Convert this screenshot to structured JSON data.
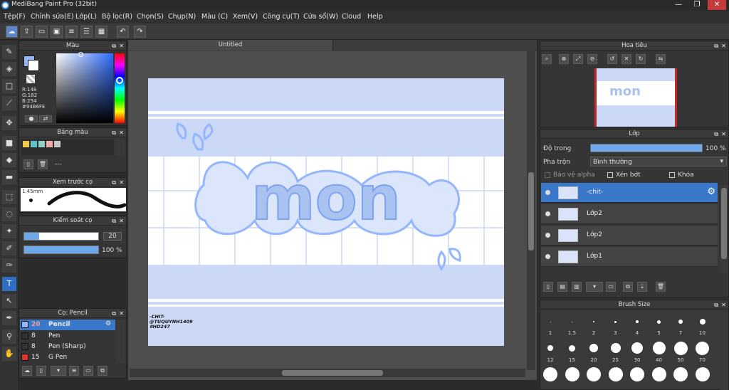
{
  "app": {
    "title": "MediBang Paint Pro (32bit)"
  },
  "window_controls": {
    "minimize": "—",
    "restore": "❐",
    "close": "✕"
  },
  "menu": [
    "Tệp(F)",
    "Chỉnh sửa(E)",
    "Lớp(L)",
    "Bộ lọc(R)",
    "Chọn(S)",
    "Chụp(N)",
    "Màu (C)",
    "Xem(V)",
    "Công cụ(T)",
    "Cửa sổ(W)",
    "Cloud",
    "Help"
  ],
  "color_panel": {
    "title": "Màu",
    "r": "R:148",
    "g": "G:182",
    "b": "B:254",
    "hex": "#94B6FE",
    "fg_color": "#94B6FE",
    "bg_color": "#FFFFFF"
  },
  "palette_panel": {
    "title": "Bảng màu",
    "swatches": [
      "#f2c94c",
      "#5fc4c9",
      "#8fd0c7",
      "#f0a8a8",
      "#c8c8c8"
    ],
    "dash": "---"
  },
  "brush_preview": {
    "title": "Xem trước cọ",
    "size": "1.45mm"
  },
  "brush_control": {
    "title": "Kiểm soát cọ",
    "size_value": "20",
    "opacity_value": "100 %",
    "size_fraction": 0.2,
    "opacity_fraction": 1.0
  },
  "brush_list": {
    "title": "Cọ: Pencil",
    "items": [
      {
        "size": "20",
        "name": "Pencil",
        "color": "#94B6FE"
      },
      {
        "size": "8",
        "name": "Pen",
        "color": "#333333"
      },
      {
        "size": "8",
        "name": "Pen (Sharp)",
        "color": "#333333"
      },
      {
        "size": "15",
        "name": "G Pen",
        "color": "#e03030"
      }
    ]
  },
  "canvas": {
    "tab_title": "Untitled",
    "art_text": "mon",
    "signature_lines": [
      "-CHIT-",
      "@TUQUYNH1409",
      "#HD247"
    ],
    "accent": "#a9c2f0"
  },
  "navigator": {
    "title": "Hoa tiêu"
  },
  "layers_panel": {
    "title": "Lớp",
    "opacity_label": "Độ trong",
    "opacity_value": "100 %",
    "opacity_fraction": 1.0,
    "blend_label": "Pha trộn",
    "blend_value": "Bình thường",
    "alpha_label": "Bảo vệ alpha",
    "clip_label": "Xén bớt",
    "lock_label": "Khóa",
    "layers": [
      {
        "name": "-chit-",
        "selected": true
      },
      {
        "name": "Lớp2",
        "selected": false
      },
      {
        "name": "Lớp2",
        "selected": false
      },
      {
        "name": "Lớp1",
        "selected": false
      }
    ]
  },
  "brush_size_panel": {
    "title": "Brush Size",
    "row1": [
      "1",
      "1.5",
      "2",
      "3",
      "4",
      "5",
      "7",
      "10"
    ],
    "row2": [
      "12",
      "15",
      "20",
      "25",
      "30",
      "40",
      "50",
      "70"
    ]
  }
}
